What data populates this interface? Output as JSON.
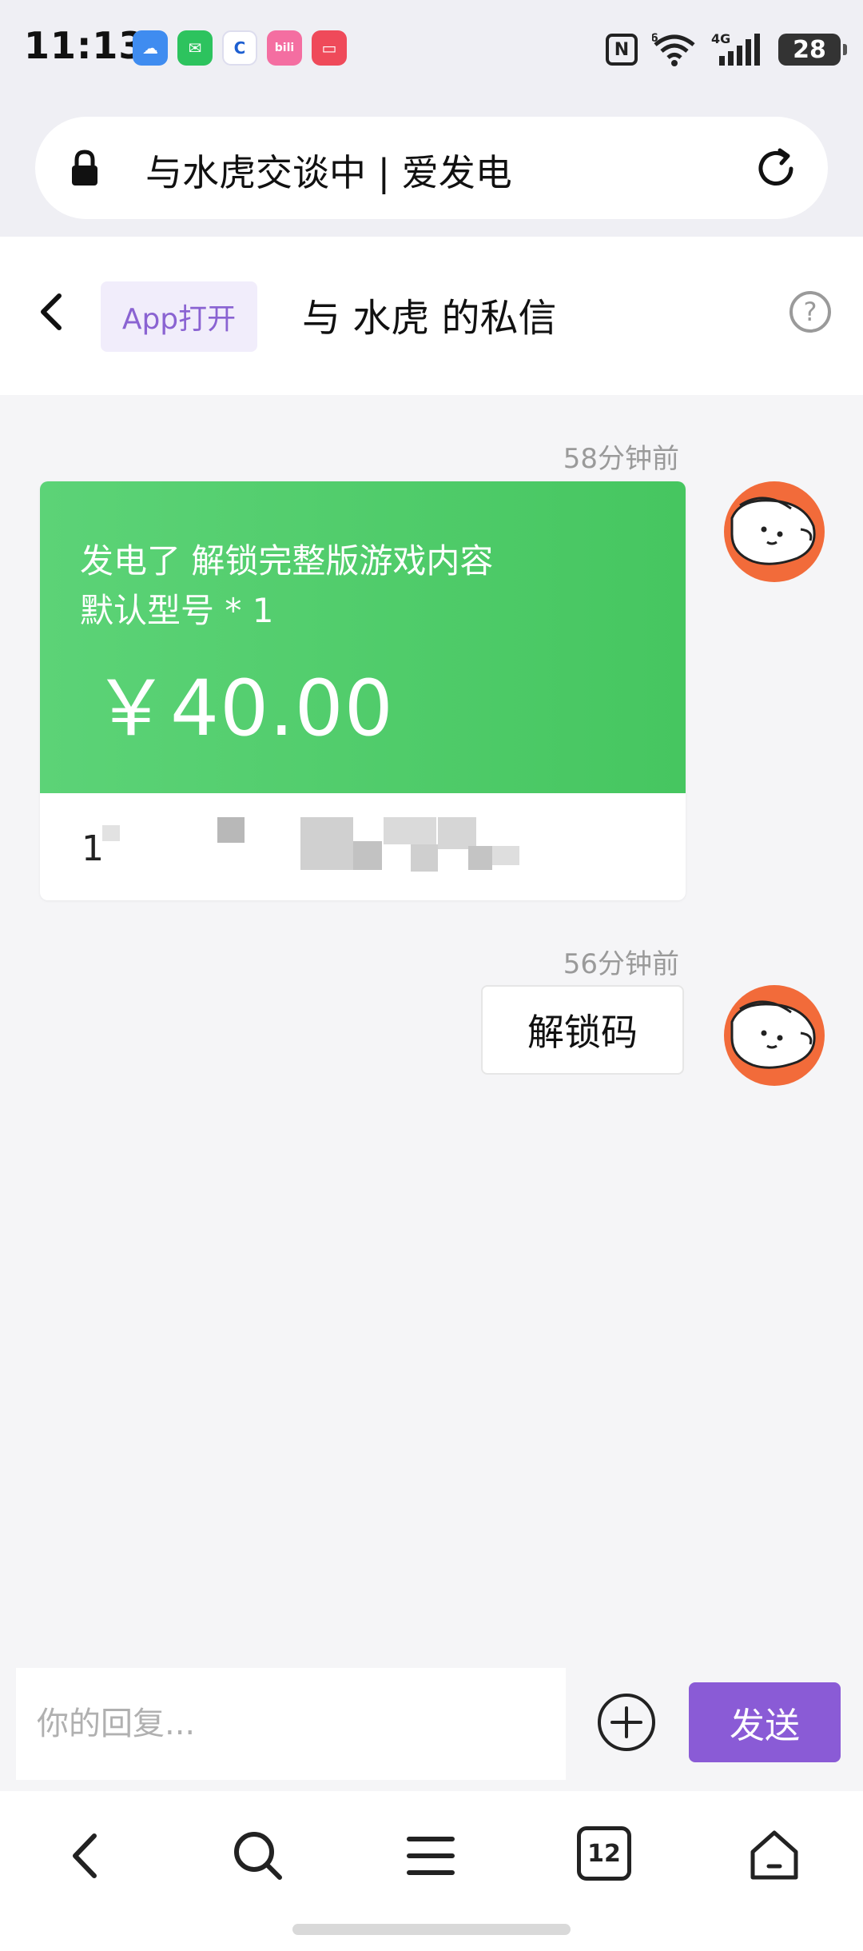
{
  "status_bar": {
    "time": "11:13",
    "battery": "28",
    "network_label": "4G",
    "wifi_badge": "6",
    "nfc_label": "N",
    "apps": [
      {
        "name": "weather-app-icon",
        "color": "#3f8cf0",
        "glyph": "☁"
      },
      {
        "name": "wechat-app-icon",
        "color": "#2dc35e",
        "glyph": "✉"
      },
      {
        "name": "browser-app-icon",
        "color": "#ffffff",
        "glyph": "C"
      },
      {
        "name": "bilibili-app-icon",
        "color": "#f46ea1",
        "glyph": "bili"
      },
      {
        "name": "book-app-icon",
        "color": "#ef4a5a",
        "glyph": "▭"
      }
    ]
  },
  "url_bar": {
    "title": "与水虎交谈中 | 爱发电"
  },
  "header": {
    "app_open_label": "App打开",
    "title": "与 水虎 的私信"
  },
  "messages": [
    {
      "timestamp": "58分钟前",
      "type": "order",
      "line1": "发电了 解锁完整版游戏内容",
      "line2": "默认型号 * 1",
      "price": "￥40.00",
      "code_prefix": "1"
    },
    {
      "timestamp": "56分钟前",
      "type": "text",
      "text": "解锁码"
    }
  ],
  "reply": {
    "placeholder": "你的回复...",
    "send_label": "发送"
  },
  "nav": {
    "tabs_count": "12"
  },
  "colors": {
    "accent_purple": "#8a5bd6",
    "order_green": "#4ec865",
    "avatar_orange": "#f26b3a"
  }
}
